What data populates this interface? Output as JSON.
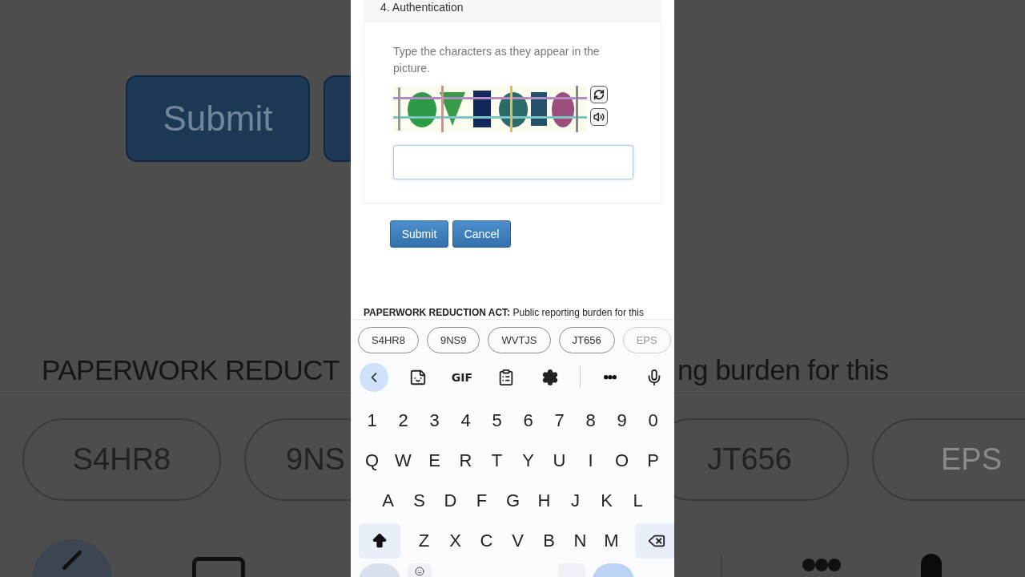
{
  "backdrop": {
    "left": {
      "buttons": [
        "Submit"
      ],
      "heading": "PAPERWORK REDUCT",
      "chips": [
        "S4HR8",
        "9NS"
      ]
    },
    "right": {
      "heading": "ng burden for this",
      "chips": [
        "JT656",
        "EPS"
      ]
    }
  },
  "form": {
    "section_title": "4. Authentication",
    "instruction": "Type the characters as they appear in the picture.",
    "buttons": [
      "Submit",
      "Cancel"
    ]
  },
  "notice": "**PAPERWORK REDUCTION ACT:** Public reporting burden for this",
  "keyboard": {
    "suggestions": [
      "S4HR8",
      "9NS9",
      "WVTJS",
      "JT656",
      "EPS"
    ],
    "toolbar": [
      {
        "kind": "back"
      },
      {
        "kind": "sticker"
      },
      {
        "kind": "text",
        "label": "GIF"
      },
      {
        "kind": "clipboard"
      },
      {
        "kind": "settings"
      },
      {
        "kind": "divider"
      },
      {
        "kind": "more"
      },
      {
        "kind": "mic"
      }
    ],
    "rows": [
      {
        "kind": "plain",
        "keys": [
          "1",
          "2",
          "3",
          "4",
          "5",
          "6",
          "7",
          "8",
          "9",
          "0"
        ]
      },
      {
        "kind": "plain",
        "keys": [
          "Q",
          "W",
          "E",
          "R",
          "T",
          "Y",
          "U",
          "I",
          "O",
          "P"
        ]
      },
      {
        "kind": "inset",
        "keys": [
          "A",
          "S",
          "D",
          "F",
          "G",
          "H",
          "J",
          "K",
          "L"
        ]
      },
      {
        "kind": "edge",
        "keys": [
          "Z",
          "X",
          "C",
          "V",
          "B",
          "N",
          "M"
        ]
      }
    ]
  }
}
